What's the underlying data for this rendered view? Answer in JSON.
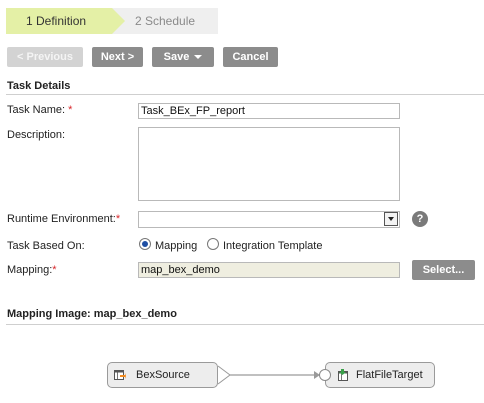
{
  "wizard": {
    "steps": [
      {
        "label": "1  Definition",
        "active": true
      },
      {
        "label": "2  Schedule",
        "active": false
      }
    ]
  },
  "toolbar": {
    "previous": "< Previous",
    "next": "Next >",
    "save": "Save",
    "cancel": "Cancel"
  },
  "task_details": {
    "title": "Task Details",
    "task_name_label": "Task Name:",
    "task_name_value": "Task_BEx_FP_report",
    "description_label": "Description:",
    "description_value": "",
    "runtime_label": "Runtime Environment:",
    "runtime_value": "",
    "based_on_label": "Task Based On:",
    "based_on_options": [
      {
        "label": "Mapping",
        "checked": true
      },
      {
        "label": "Integration Template",
        "checked": false
      }
    ],
    "mapping_label": "Mapping:",
    "mapping_value": "map_bex_demo",
    "select_button": "Select...",
    "required_mark": "*",
    "help_icon": "?"
  },
  "mapping_image": {
    "title": "Mapping Image:  map_bex_demo",
    "source_node": "BexSource",
    "target_node": "FlatFileTarget"
  },
  "colors": {
    "step_active": "#e4f0a6",
    "step_inactive": "#efefef",
    "button": "#8c8c8c",
    "button_disabled": "#d3d3d3",
    "required": "#d8262a"
  }
}
